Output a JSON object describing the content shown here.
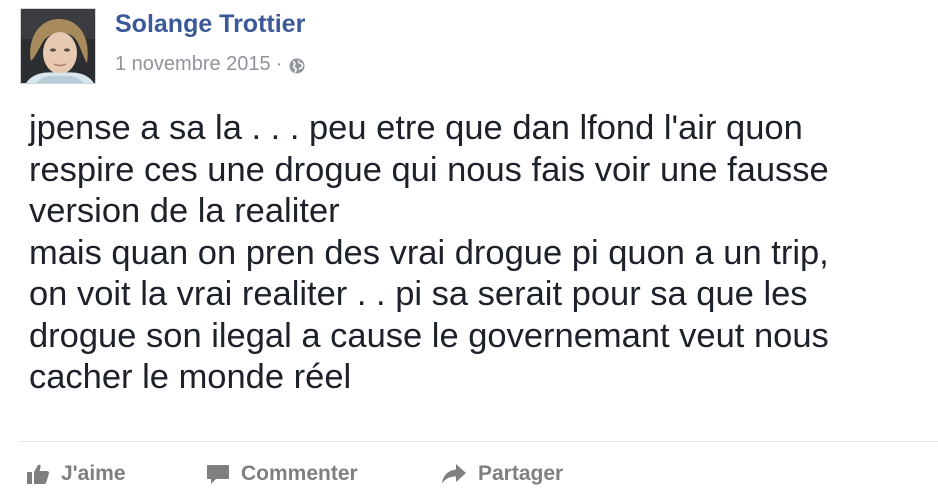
{
  "post": {
    "author": "Solange Trottier",
    "date": "1 novembre 2015",
    "separator": "·",
    "privacy_icon": "globe-icon",
    "text": "jpense a sa la . . . peu etre que dan lfond l'air quon\nrespire ces une drogue qui nous fais voir une fausse\nversion de la realiter\nmais quan on pren des vrai drogue pi quon a un trip,\non voit la vrai realiter . . pi sa serait pour sa que les\ndrogue son ilegal a cause le governemant veut nous\ncacher le monde réel"
  },
  "actions": {
    "like_label": "J'aime",
    "comment_label": "Commenter",
    "share_label": "Partager"
  },
  "colors": {
    "author_link": "#3b5998",
    "meta_text": "#90949c",
    "body_text": "#1d2129",
    "action_text": "#7f7f7f",
    "divider": "#e5e5e5"
  }
}
